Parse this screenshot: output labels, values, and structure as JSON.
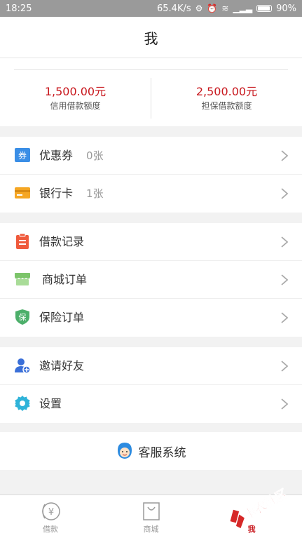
{
  "status_bar": {
    "time": "18:25",
    "network_speed": "65.4K/s",
    "battery": "90%"
  },
  "header": {
    "title": "我"
  },
  "quota": {
    "credit_amount": "1,500.00元",
    "credit_label": "信用借款额度",
    "guarantee_amount": "2,500.00元",
    "guarantee_label": "担保借款额度"
  },
  "group1": [
    {
      "label": "优惠券",
      "count": "0张",
      "icon": "coupon-icon"
    },
    {
      "label": "银行卡",
      "count": "1张",
      "icon": "bank-card-icon"
    }
  ],
  "group2": [
    {
      "label": "借款记录",
      "icon": "clipboard-icon"
    },
    {
      "label": "商城订单",
      "icon": "store-icon"
    },
    {
      "label": "保险订单",
      "icon": "insurance-shield-icon"
    }
  ],
  "group3": [
    {
      "label": "邀请好友",
      "icon": "invite-user-icon"
    },
    {
      "label": "设置",
      "icon": "settings-gear-icon"
    }
  ],
  "service": {
    "label": "客服系统",
    "icon": "customer-service-avatar-icon"
  },
  "tabbar": {
    "loan": "借款",
    "mall": "商城",
    "me": "我"
  },
  "watermark": {
    "text": "卡农社区"
  },
  "colors": {
    "accent": "#c8171d",
    "background": "#f2f2f2"
  }
}
